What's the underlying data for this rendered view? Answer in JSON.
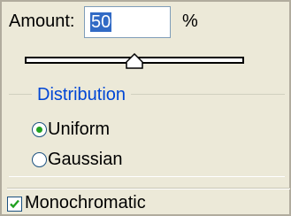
{
  "amount": {
    "label": "Amount:",
    "value": "50",
    "unit": "%"
  },
  "slider": {
    "value_percent": 50
  },
  "distribution": {
    "title": "Distribution",
    "options": [
      {
        "label": "Uniform",
        "selected": true
      },
      {
        "label": "Gaussian",
        "selected": false
      }
    ]
  },
  "monochromatic": {
    "label": "Monochromatic",
    "checked": true
  },
  "colors": {
    "panel_bg": "#ece9d8",
    "group_title": "#0046d5",
    "selection_bg": "#316ac5",
    "radio_dot": "#21a121",
    "check_mark": "#21a121"
  }
}
